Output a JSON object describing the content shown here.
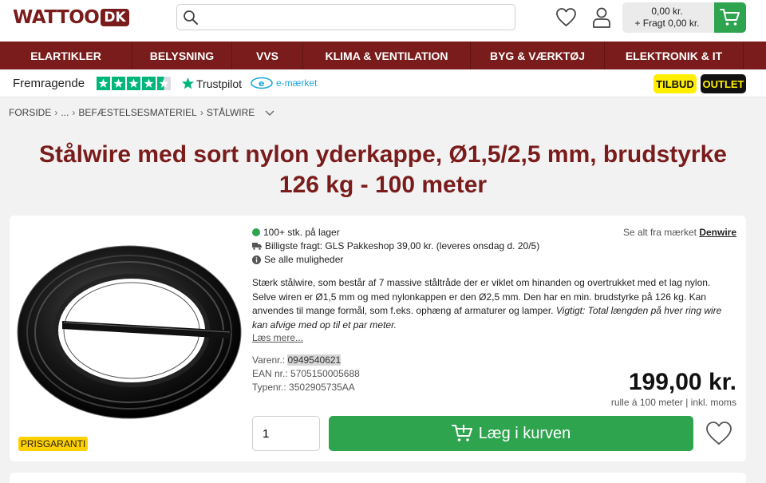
{
  "header": {
    "logo_text": "WATTOO",
    "logo_suffix": "DK",
    "search_placeholder": "",
    "cart_total": "0,00 kr.",
    "cart_freight": "+ Fragt 0,00 kr."
  },
  "nav": {
    "items": [
      {
        "label": "ELARTIKLER"
      },
      {
        "label": "BELYSNING"
      },
      {
        "label": "VVS"
      },
      {
        "label": "KLIMA & VENTILATION"
      },
      {
        "label": "BYG & VÆRKTØJ"
      },
      {
        "label": "ELEKTRONIK & IT"
      }
    ]
  },
  "trust": {
    "rating_label": "Fremragende",
    "trustpilot": "Trustpilot",
    "emark": "e-mærket",
    "tilbud": "TILBUD",
    "outlet": "OUTLET",
    "star_color": "#00b67a"
  },
  "breadcrumb": {
    "items": [
      "FORSIDE",
      "...",
      "BEFÆSTELSESMATERIEL",
      "STÅLWIRE"
    ]
  },
  "product": {
    "title": "Stålwire med sort nylon yderkappe, Ø1,5/2,5 mm, brudstyrke 126 kg - 100 meter",
    "stock": "100+ stk. på lager",
    "freight": "Billigste fragt: GLS Pakkeshop 39,00 kr. (leveres onsdag d. 20/5)",
    "options": "Se alle muligheder",
    "brand_prefix": "Se alt fra mærket",
    "brand": "Denwire",
    "description": "Stærk stålwire, som består af 7 massive ståltråde der er viklet om hinanden og overtrukket med et lag nylon. Selve wiren er Ø1,5 mm og med nylonkappen er den Ø2,5 mm. Den har en min. brudstyrke på 126 kg. Kan anvendes til mange formål, som f.eks. ophæng af armaturer og lamper.",
    "description_note": "Vigtigt: Total længden på hver ring wire kan afvige med op til et par meter.",
    "read_more": "Læs mere...",
    "varenr_label": "Varenr.:",
    "varenr": "0949540621",
    "ean_label": "EAN nr.:",
    "ean": "5705150005688",
    "typenr_label": "Typenr.:",
    "typenr": "3502905735AA",
    "price": "199,00 kr.",
    "price_note": "rulle á 100 meter | inkl. moms",
    "quantity": "1",
    "add_to_cart": "Læg i kurven",
    "prisgaranti": "PRISGARANTI"
  },
  "colors": {
    "brand": "#7a1c1c",
    "green": "#2ea44f",
    "yellow": "#ffee00"
  }
}
